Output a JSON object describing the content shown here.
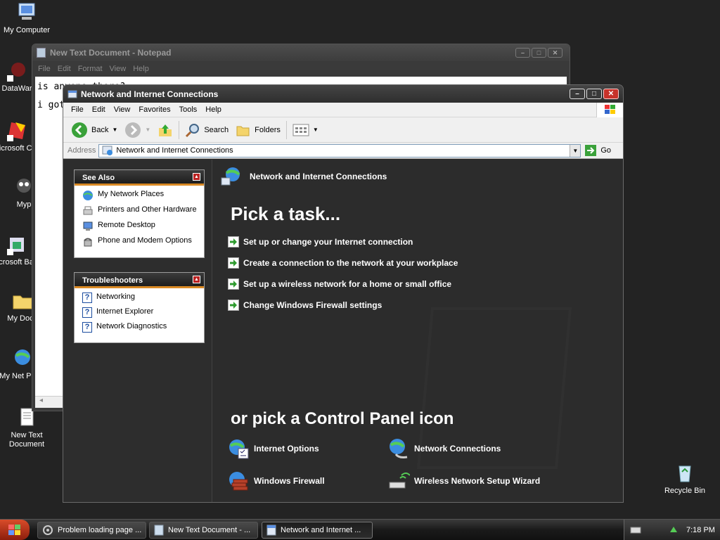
{
  "desktop": {
    "icons": [
      {
        "label": "My Computer",
        "icon": "my-computer-icon"
      },
      {
        "label": "DataWar",
        "icon": "shortcut-icon"
      },
      {
        "label": "Microsoft C++",
        "icon": "shortcut-icon"
      },
      {
        "label": "Myp",
        "icon": "shortcut-icon"
      },
      {
        "label": "Microsoft Basic",
        "icon": "shortcut-icon"
      },
      {
        "label": "My Docu",
        "icon": "folder-icon"
      },
      {
        "label": "My Net Place",
        "icon": "network-icon"
      },
      {
        "label": "New Text Document",
        "icon": "text-file-icon"
      },
      {
        "label": "Recycle Bin",
        "icon": "recycle-bin-icon"
      }
    ]
  },
  "notepad": {
    "title": "New Text Document - Notepad",
    "menu": [
      "File",
      "Edit",
      "Format",
      "View",
      "Help"
    ],
    "lines": [
      "is anyone there?",
      "i got"
    ],
    "scroll_glyph": "◂"
  },
  "explorer": {
    "title": "Network and Internet Connections",
    "menu": [
      "File",
      "Edit",
      "View",
      "Favorites",
      "Tools",
      "Help"
    ],
    "toolbar": {
      "back": "Back",
      "search": "Search",
      "folders": "Folders"
    },
    "address": {
      "label": "Address",
      "value": "Network and Internet Connections",
      "go": "Go"
    },
    "see_also": {
      "title": "See Also",
      "items": [
        {
          "label": "My Network Places",
          "icon": "network-places-icon"
        },
        {
          "label": "Printers and Other Hardware",
          "icon": "printer-icon"
        },
        {
          "label": "Remote Desktop",
          "icon": "remote-desktop-icon"
        },
        {
          "label": "Phone and Modem Options",
          "icon": "phone-icon"
        }
      ]
    },
    "troubleshooters": {
      "title": "Troubleshooters",
      "items": [
        {
          "label": "Networking"
        },
        {
          "label": "Internet Explorer"
        },
        {
          "label": "Network Diagnostics"
        }
      ]
    },
    "header": "Network and Internet Connections",
    "pick_task": "Pick a task...",
    "tasks": [
      "Set up or change your Internet connection",
      "Create a connection to the network at your workplace",
      "Set up a wireless network for a home or small office",
      "Change Windows Firewall settings"
    ],
    "pick_icon": "or pick a Control Panel icon",
    "cp_icons": [
      {
        "label": "Internet Options",
        "icon": "internet-options-icon"
      },
      {
        "label": "Network Connections",
        "icon": "network-connections-icon"
      },
      {
        "label": "Windows Firewall",
        "icon": "firewall-icon"
      },
      {
        "label": "Wireless Network Setup Wizard",
        "icon": "wireless-icon"
      }
    ]
  },
  "taskbar": {
    "buttons": [
      {
        "label": "Problem loading page ...",
        "icon": "browser-icon"
      },
      {
        "label": "New Text Document - ...",
        "icon": "notepad-icon"
      },
      {
        "label": "Network and Internet ...",
        "icon": "folder-window-icon"
      }
    ],
    "clock": "7:18 PM"
  }
}
